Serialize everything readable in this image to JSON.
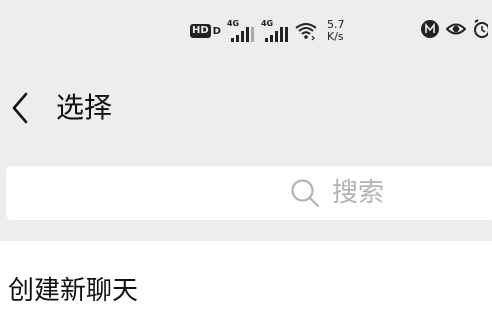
{
  "status_bar": {
    "hd_label": "HD",
    "hd_sub": "D",
    "signal_1_label": "4G",
    "signal_2_label": "4G",
    "speed_value": "5.7",
    "speed_unit": "K/s"
  },
  "header": {
    "back_icon": "chevron-left-icon",
    "title": "选择"
  },
  "search": {
    "icon": "search-icon",
    "placeholder": "搜索"
  },
  "list": {
    "items": [
      {
        "label": "创建新聊天"
      }
    ]
  }
}
